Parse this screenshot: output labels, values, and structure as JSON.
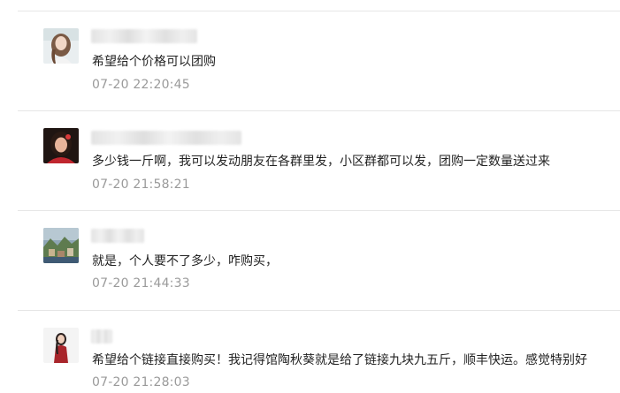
{
  "comments": [
    {
      "avatar": "user-avatar",
      "text": "希望给个价格可以团购",
      "time": "07-20 22:20:45"
    },
    {
      "avatar": "user-avatar",
      "text": "多少钱一斤啊，我可以发动朋友在各群里发，小区群都可以发，团购一定数量送过来",
      "time": "07-20 21:58:21"
    },
    {
      "avatar": "user-avatar",
      "text": "就是，个人要不了多少，咋购买，",
      "time": "07-20 21:44:33"
    },
    {
      "avatar": "user-avatar",
      "text": "希望给个链接直接购买！我记得馆陶秋葵就是给了链接九块九五斤，顺丰快运。感觉特别好",
      "time": "07-20 21:28:03"
    }
  ]
}
